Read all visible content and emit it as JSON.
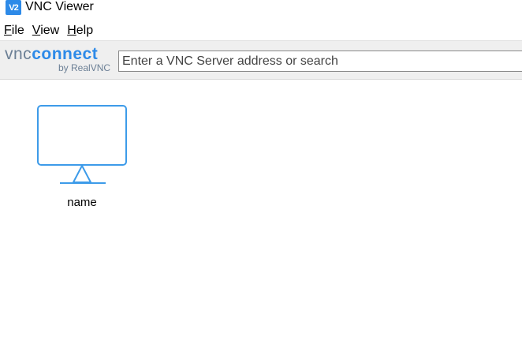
{
  "window": {
    "icon_text": "V2",
    "title": "VNC Viewer"
  },
  "menu": {
    "file": {
      "accel": "F",
      "rest": "ile"
    },
    "view": {
      "accel": "V",
      "rest": "iew"
    },
    "help": {
      "accel": "H",
      "rest": "elp"
    }
  },
  "toolbar": {
    "logo_vnc": "vnc",
    "logo_connect": "connect",
    "logo_sub": "by RealVNC",
    "search_placeholder": "Enter a VNC Server address or search"
  },
  "connections": [
    {
      "name": "name",
      "icon": "monitor-icon"
    }
  ],
  "colors": {
    "accent": "#2d8ae8",
    "logo_gray": "#6b7f95",
    "toolbar_bg": "#efefef"
  }
}
